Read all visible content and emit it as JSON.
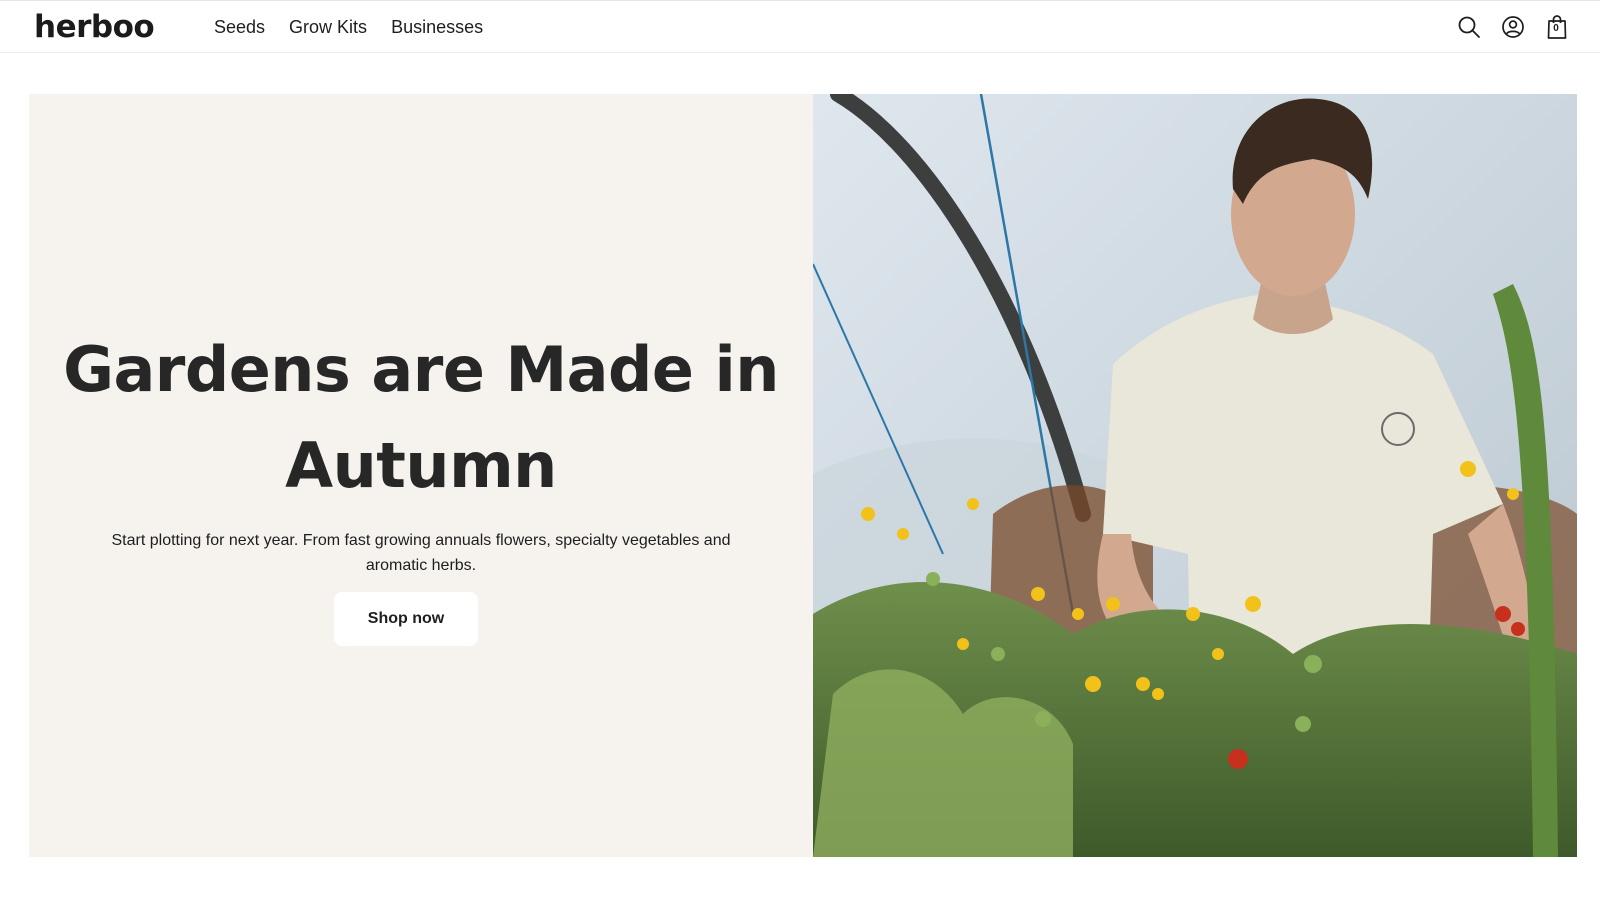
{
  "brand": {
    "logo": "herboo"
  },
  "nav": {
    "items": [
      {
        "label": "Seeds"
      },
      {
        "label": "Grow Kits"
      },
      {
        "label": "Businesses"
      }
    ]
  },
  "header_icons": {
    "search": "search-icon",
    "account": "user-icon",
    "cart": "shopping-bag-icon",
    "cart_count": "0"
  },
  "hero": {
    "title_line1": "Gardens are Made in",
    "title_line2": "Autumn",
    "subtitle": "Start plotting for next year. From fast growing annuals flowers, specialty vegetables and aromatic herbs.",
    "cta_label": "Shop now"
  },
  "colors": {
    "hero_bg": "#f6f3ef",
    "text": "#1e1e1e",
    "button_bg": "#ffffff"
  }
}
